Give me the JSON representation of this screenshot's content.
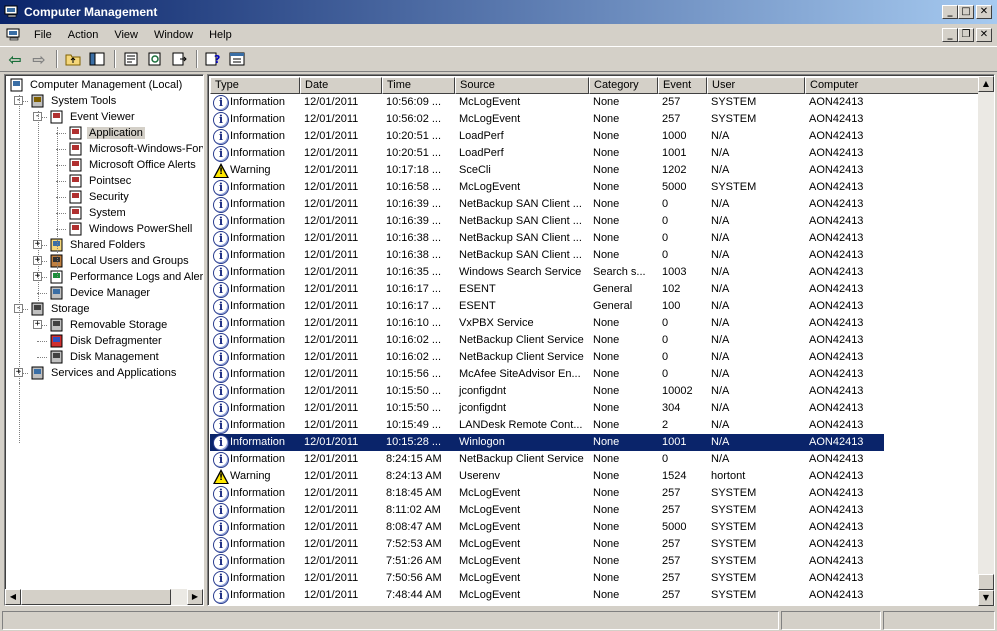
{
  "window": {
    "title": "Computer Management",
    "minimize_glyph": "_",
    "maximize_glyph": "□",
    "close_glyph": "✕"
  },
  "menu": [
    "File",
    "Action",
    "View",
    "Window",
    "Help"
  ],
  "child_window_controls": {
    "minimize_glyph": "_",
    "restore_glyph": "❐",
    "close_glyph": "✕"
  },
  "toolbar": {
    "icons": [
      "back-arrow-icon",
      "forward-arrow-icon",
      "up-one-level-icon",
      "show-hide-console-tree-icon",
      "properties-icon",
      "refresh-icon",
      "export-list-icon",
      "help-icon",
      "show-hide-action-pane-icon"
    ],
    "back_glyph": "⇦",
    "forward_glyph": "⇨"
  },
  "tree": {
    "expander_open": "-",
    "expander_closed": "+",
    "nodes": [
      {
        "label": "Computer Management (Local)",
        "icon": "computer-icon",
        "level": 0,
        "expander": ""
      },
      {
        "label": "System Tools",
        "icon": "system-tools-icon",
        "level": 1,
        "expander": "-"
      },
      {
        "label": "Event Viewer",
        "icon": "event-viewer-icon",
        "level": 2,
        "expander": "-"
      },
      {
        "label": "Application",
        "icon": "event-log-icon",
        "level": 3,
        "expander": "",
        "selected": true
      },
      {
        "label": "Microsoft-Windows-Forw",
        "icon": "event-log-icon",
        "level": 3,
        "expander": ""
      },
      {
        "label": "Microsoft Office Alerts",
        "icon": "event-log-icon",
        "level": 3,
        "expander": ""
      },
      {
        "label": "Pointsec",
        "icon": "event-log-icon",
        "level": 3,
        "expander": ""
      },
      {
        "label": "Security",
        "icon": "event-log-icon",
        "level": 3,
        "expander": ""
      },
      {
        "label": "System",
        "icon": "event-log-icon",
        "level": 3,
        "expander": ""
      },
      {
        "label": "Windows PowerShell",
        "icon": "event-log-icon",
        "level": 3,
        "expander": ""
      },
      {
        "label": "Shared Folders",
        "icon": "shared-folder-icon",
        "level": 2,
        "expander": "+"
      },
      {
        "label": "Local Users and Groups",
        "icon": "users-icon",
        "level": 2,
        "expander": "+"
      },
      {
        "label": "Performance Logs and Alerts",
        "icon": "performance-icon",
        "level": 2,
        "expander": "+"
      },
      {
        "label": "Device Manager",
        "icon": "device-manager-icon",
        "level": 2,
        "expander": ""
      },
      {
        "label": "Storage",
        "icon": "storage-icon",
        "level": 1,
        "expander": "-"
      },
      {
        "label": "Removable Storage",
        "icon": "removable-storage-icon",
        "level": 2,
        "expander": "+"
      },
      {
        "label": "Disk Defragmenter",
        "icon": "defrag-icon",
        "level": 2,
        "expander": ""
      },
      {
        "label": "Disk Management",
        "icon": "disk-management-icon",
        "level": 2,
        "expander": ""
      },
      {
        "label": "Services and Applications",
        "icon": "services-icon",
        "level": 1,
        "expander": "+"
      }
    ],
    "scroll_left_glyph": "◀",
    "scroll_right_glyph": "▶"
  },
  "list": {
    "columns": [
      "Type",
      "Date",
      "Time",
      "Source",
      "Category",
      "Event",
      "User",
      "Computer"
    ],
    "warning_glyph": "!",
    "info_glyph": "i",
    "rows": [
      [
        "Information",
        "12/01/2011",
        "10:56:09 ...",
        "McLogEvent",
        "None",
        "257",
        "SYSTEM",
        "AON42413"
      ],
      [
        "Information",
        "12/01/2011",
        "10:56:02 ...",
        "McLogEvent",
        "None",
        "257",
        "SYSTEM",
        "AON42413"
      ],
      [
        "Information",
        "12/01/2011",
        "10:20:51 ...",
        "LoadPerf",
        "None",
        "1000",
        "N/A",
        "AON42413"
      ],
      [
        "Information",
        "12/01/2011",
        "10:20:51 ...",
        "LoadPerf",
        "None",
        "1001",
        "N/A",
        "AON42413"
      ],
      [
        "Warning",
        "12/01/2011",
        "10:17:18 ...",
        "SceCli",
        "None",
        "1202",
        "N/A",
        "AON42413"
      ],
      [
        "Information",
        "12/01/2011",
        "10:16:58 ...",
        "McLogEvent",
        "None",
        "5000",
        "SYSTEM",
        "AON42413"
      ],
      [
        "Information",
        "12/01/2011",
        "10:16:39 ...",
        "NetBackup SAN Client ...",
        "None",
        "0",
        "N/A",
        "AON42413"
      ],
      [
        "Information",
        "12/01/2011",
        "10:16:39 ...",
        "NetBackup SAN Client ...",
        "None",
        "0",
        "N/A",
        "AON42413"
      ],
      [
        "Information",
        "12/01/2011",
        "10:16:38 ...",
        "NetBackup SAN Client ...",
        "None",
        "0",
        "N/A",
        "AON42413"
      ],
      [
        "Information",
        "12/01/2011",
        "10:16:38 ...",
        "NetBackup SAN Client ...",
        "None",
        "0",
        "N/A",
        "AON42413"
      ],
      [
        "Information",
        "12/01/2011",
        "10:16:35 ...",
        "Windows Search Service",
        "Search s...",
        "1003",
        "N/A",
        "AON42413"
      ],
      [
        "Information",
        "12/01/2011",
        "10:16:17 ...",
        "ESENT",
        "General",
        "102",
        "N/A",
        "AON42413"
      ],
      [
        "Information",
        "12/01/2011",
        "10:16:17 ...",
        "ESENT",
        "General",
        "100",
        "N/A",
        "AON42413"
      ],
      [
        "Information",
        "12/01/2011",
        "10:16:10 ...",
        "VxPBX Service",
        "None",
        "0",
        "N/A",
        "AON42413"
      ],
      [
        "Information",
        "12/01/2011",
        "10:16:02 ...",
        "NetBackup Client Service",
        "None",
        "0",
        "N/A",
        "AON42413"
      ],
      [
        "Information",
        "12/01/2011",
        "10:16:02 ...",
        "NetBackup Client Service",
        "None",
        "0",
        "N/A",
        "AON42413"
      ],
      [
        "Information",
        "12/01/2011",
        "10:15:56 ...",
        "McAfee SiteAdvisor En...",
        "None",
        "0",
        "N/A",
        "AON42413"
      ],
      [
        "Information",
        "12/01/2011",
        "10:15:50 ...",
        "jconfigdnt",
        "None",
        "10002",
        "N/A",
        "AON42413"
      ],
      [
        "Information",
        "12/01/2011",
        "10:15:50 ...",
        "jconfigdnt",
        "None",
        "304",
        "N/A",
        "AON42413"
      ],
      [
        "Information",
        "12/01/2011",
        "10:15:49 ...",
        "LANDesk Remote Cont...",
        "None",
        "2",
        "N/A",
        "AON42413"
      ],
      [
        "Information",
        "12/01/2011",
        "10:15:28 ...",
        "Winlogon",
        "None",
        "1001",
        "N/A",
        "AON42413"
      ],
      [
        "Information",
        "12/01/2011",
        "8:24:15 AM",
        "NetBackup Client Service",
        "None",
        "0",
        "N/A",
        "AON42413"
      ],
      [
        "Warning",
        "12/01/2011",
        "8:24:13 AM",
        "Userenv",
        "None",
        "1524",
        "hortont",
        "AON42413"
      ],
      [
        "Information",
        "12/01/2011",
        "8:18:45 AM",
        "McLogEvent",
        "None",
        "257",
        "SYSTEM",
        "AON42413"
      ],
      [
        "Information",
        "12/01/2011",
        "8:11:02 AM",
        "McLogEvent",
        "None",
        "257",
        "SYSTEM",
        "AON42413"
      ],
      [
        "Information",
        "12/01/2011",
        "8:08:47 AM",
        "McLogEvent",
        "None",
        "5000",
        "SYSTEM",
        "AON42413"
      ],
      [
        "Information",
        "12/01/2011",
        "7:52:53 AM",
        "McLogEvent",
        "None",
        "257",
        "SYSTEM",
        "AON42413"
      ],
      [
        "Information",
        "12/01/2011",
        "7:51:26 AM",
        "McLogEvent",
        "None",
        "257",
        "SYSTEM",
        "AON42413"
      ],
      [
        "Information",
        "12/01/2011",
        "7:50:56 AM",
        "McLogEvent",
        "None",
        "257",
        "SYSTEM",
        "AON42413"
      ],
      [
        "Information",
        "12/01/2011",
        "7:48:44 AM",
        "McLogEvent",
        "None",
        "257",
        "SYSTEM",
        "AON42413"
      ]
    ],
    "selected_row": 20,
    "scroll_up_glyph": "▲",
    "scroll_down_glyph": "▼"
  },
  "colors": {
    "titlebar_start": "#0a246a",
    "titlebar_end": "#a6caf0",
    "selection": "#0a246a",
    "face": "#d4d0c8"
  }
}
